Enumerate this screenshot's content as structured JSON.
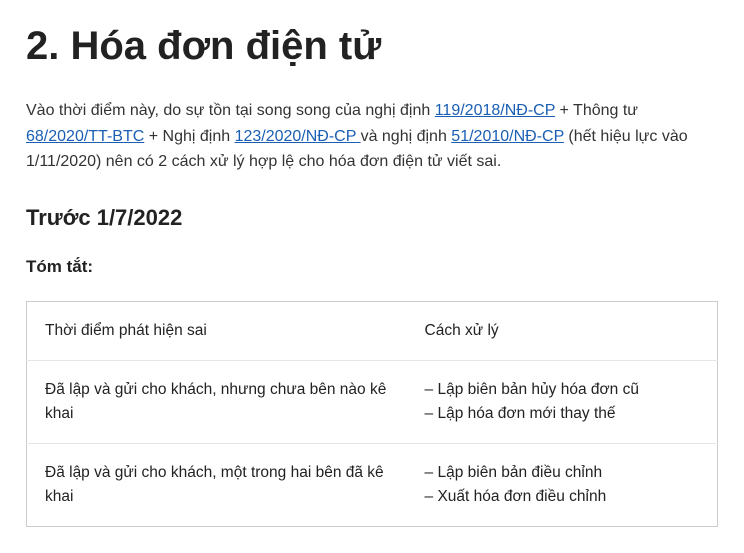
{
  "heading": "2. Hóa đơn điện tử",
  "intro": {
    "t1": "Vào thời điểm này, do sự tồn tại song song của nghị định ",
    "link1": "119/2018/NĐ-CP",
    "t2": " + Thông tư ",
    "link2": "68/2020/TT-BTC",
    "t3": " + Nghị định ",
    "link3": "123/2020/NĐ-CP ",
    "t4": "và nghị định ",
    "link4": "51/2010/NĐ-CP",
    "t5": " (hết hiệu lực vào 1/11/2020) nên có 2 cách xử lý hợp lệ cho hóa đơn điện tử viết sai."
  },
  "subheading": "Trước 1/7/2022",
  "summary_label": "Tóm tắt:",
  "table": {
    "headers": [
      "Thời điểm phát hiện sai",
      "Cách xử lý"
    ],
    "rows": [
      {
        "c1": "Đã lập và gửi cho khách, nhưng chưa bên nào kê khai",
        "c2a": "– Lập biên bản hủy hóa đơn cũ",
        "c2b": "– Lập hóa đơn mới thay thế"
      },
      {
        "c1": "Đã lập và gửi cho khách, một trong hai bên đã kê khai",
        "c2a": "– Lập biên bản điều chỉnh",
        "c2b": "– Xuất hóa đơn điều chỉnh"
      }
    ]
  }
}
